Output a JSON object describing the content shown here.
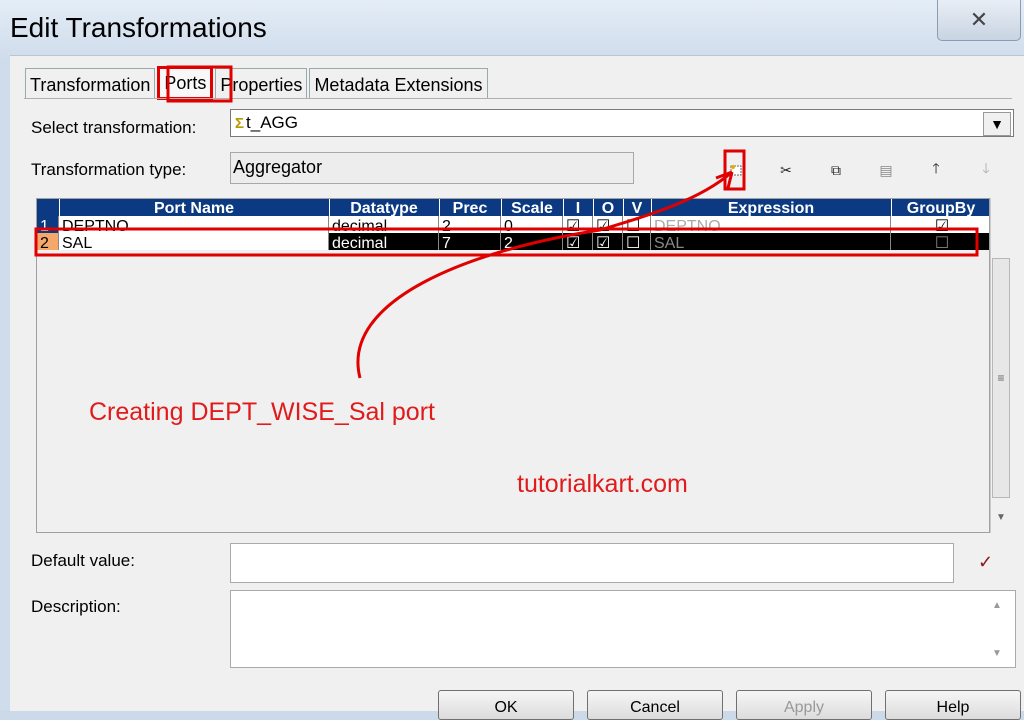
{
  "window": {
    "title": "Edit Transformations",
    "close_glyph": "✕"
  },
  "tabs": [
    {
      "label": "Transformation",
      "active": false
    },
    {
      "label": "Ports",
      "active": true
    },
    {
      "label": "Properties",
      "active": false
    },
    {
      "label": "Metadata Extensions",
      "active": false
    }
  ],
  "form": {
    "select_label": "Select transformation:",
    "select_value": "t_AGG",
    "select_icon": "sigma-icon",
    "type_label": "Transformation type:",
    "type_value": "Aggregator",
    "default_label": "Default value:",
    "default_value": "",
    "description_label": "Description:",
    "description_value": ""
  },
  "toolbar": [
    {
      "name": "new-port-icon"
    },
    {
      "name": "cut-icon",
      "glyph": "✂"
    },
    {
      "name": "copy-icon",
      "glyph": "⧉"
    },
    {
      "name": "paste-icon",
      "glyph": "▤"
    },
    {
      "name": "move-up-icon",
      "glyph": "🡑"
    },
    {
      "name": "move-down-icon",
      "glyph": "🡓"
    }
  ],
  "grid": {
    "columns": [
      "Port Name",
      "Datatype",
      "Prec",
      "Scale",
      "I",
      "O",
      "V",
      "Expression",
      "GroupBy"
    ],
    "rows": [
      {
        "num": "1",
        "name": "DEPTNO",
        "datatype": "decimal",
        "prec": "2",
        "scale": "0",
        "i": "☑",
        "o": "☑",
        "v": "☐",
        "expression": "DEPTNO",
        "groupby": "☑"
      },
      {
        "num": "2",
        "name": "SAL",
        "datatype": "decimal",
        "prec": "7",
        "scale": "2",
        "i": "☑",
        "o": "☑",
        "v": "☐",
        "expression": "SAL",
        "groupby": "☐"
      }
    ]
  },
  "buttons": {
    "ok": "OK",
    "cancel": "Cancel",
    "apply": "Apply",
    "help": "Help"
  },
  "annotations": {
    "caption": "Creating DEPT_WISE_Sal port",
    "watermark": "tutorialkart.com",
    "color": "#e01b1b"
  }
}
